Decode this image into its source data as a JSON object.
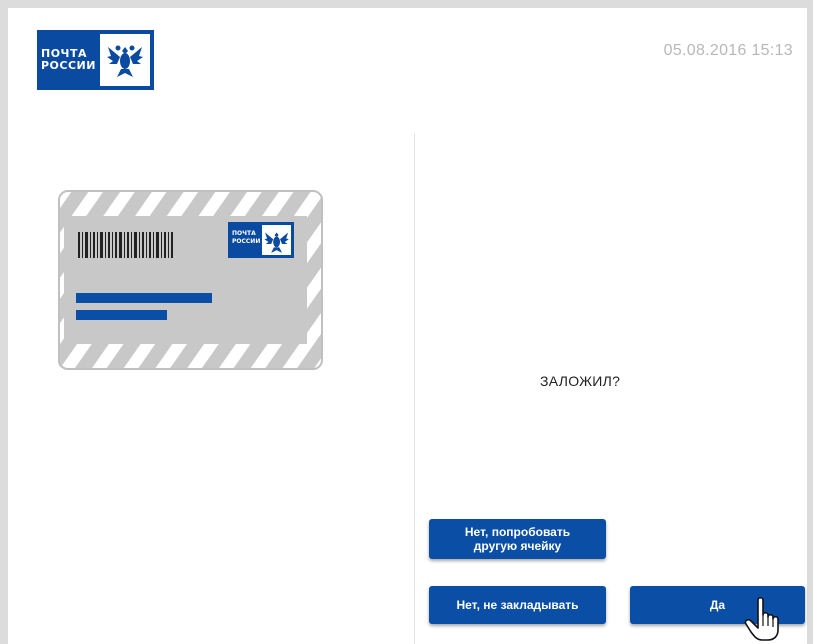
{
  "header": {
    "logo_line1": "ПОЧТА",
    "logo_line2": "РОССИИ",
    "datetime": "05.08.2016  15:13"
  },
  "envelope_logo": {
    "line1": "ПОЧТА",
    "line2": "РОССИИ"
  },
  "main": {
    "question": "ЗАЛОЖИЛ?"
  },
  "buttons": {
    "retry": "Нет, попробовать\nдругую ячейку",
    "no": "Нет, не закладывать",
    "yes": "Да"
  },
  "colors": {
    "brand_blue": "#0a4aa0",
    "button_blue": "#0a4ea6",
    "envelope_gray": "#c8c8c8"
  },
  "icons": [
    "russian-post-logo",
    "double-headed-eagle-icon",
    "barcode-icon",
    "hand-pointer-cursor-icon"
  ]
}
